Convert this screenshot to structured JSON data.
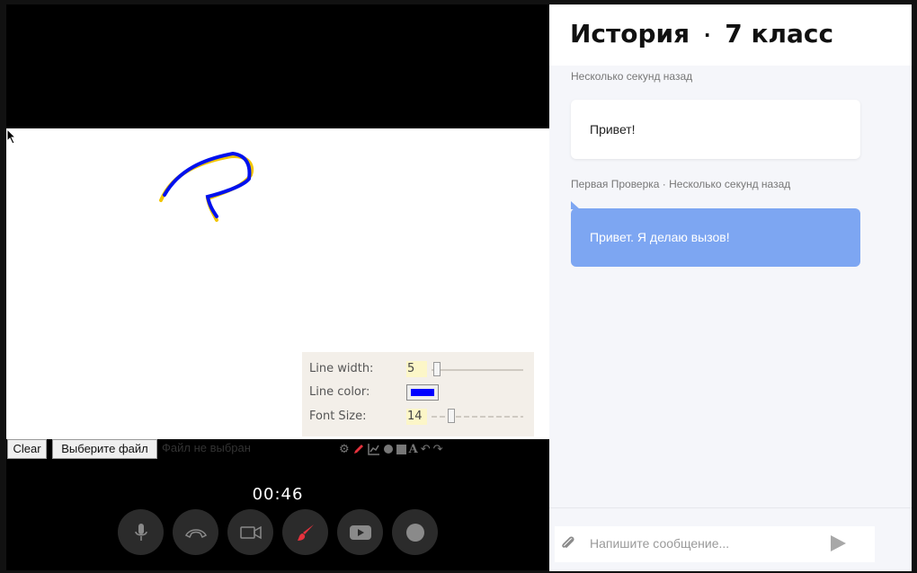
{
  "whiteboard": {
    "tool_panel": {
      "line_width_label": "Line width:",
      "line_width_value": "5",
      "line_color_label": "Line color:",
      "line_color": "#0000ff",
      "font_size_label": "Font Size:",
      "font_size_value": "14"
    },
    "clear_label": "Clear",
    "choose_file_label": "Выберите файл",
    "no_file_label": "Файл не выбран",
    "stroke_colors": [
      "#f2c500",
      "#0011ee"
    ]
  },
  "call": {
    "timer": "00:46",
    "controls": [
      "microphone-icon",
      "hang-up-icon",
      "camera-icon",
      "brush-icon",
      "youtube-icon",
      "record-icon"
    ],
    "accent": "#e5323d"
  },
  "chat": {
    "title_subject": "История",
    "title_separator": "·",
    "title_grade": "7 класс",
    "messages": [
      {
        "meta": "Несколько секунд назад",
        "text": "Привет!"
      },
      {
        "meta": "Первая Проверка · Несколько секунд назад",
        "text": "Привет. Я делаю вызов!"
      }
    ],
    "input_placeholder": "Напишите сообщение...",
    "own_bubble_color": "#7da6f2"
  }
}
